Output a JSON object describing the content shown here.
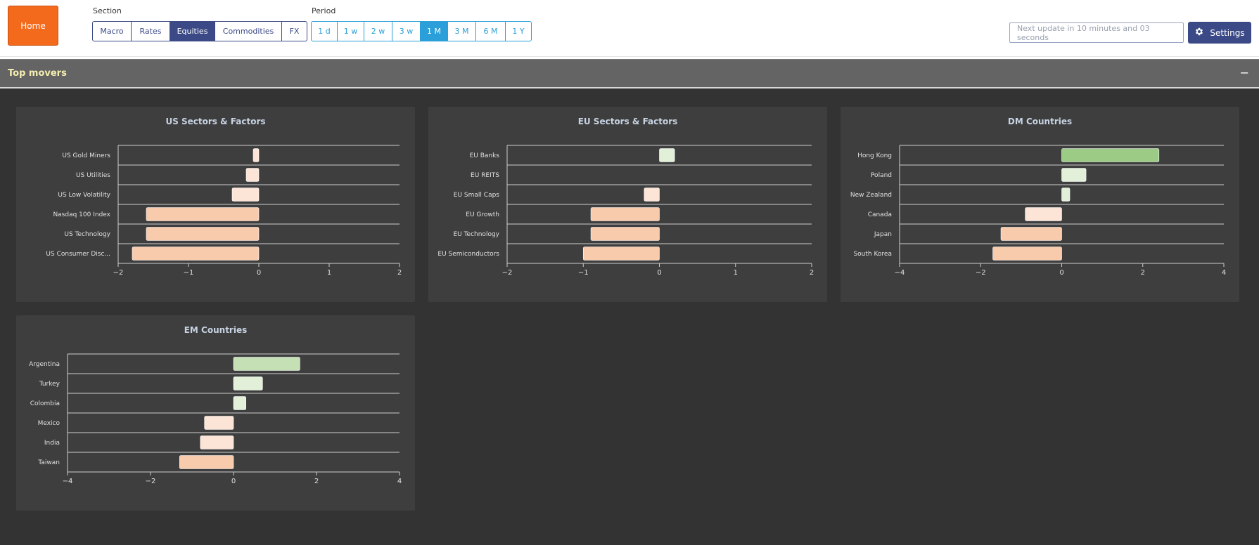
{
  "toolbar": {
    "home_label": "Home",
    "section_label": "Section",
    "sections": [
      {
        "label": "Macro",
        "active": false
      },
      {
        "label": "Rates",
        "active": false
      },
      {
        "label": "Equities",
        "active": true
      },
      {
        "label": "Commodities",
        "active": false
      },
      {
        "label": "FX",
        "active": false
      }
    ],
    "period_label": "Period",
    "periods": [
      {
        "label": "1 d",
        "active": false
      },
      {
        "label": "1 w",
        "active": false
      },
      {
        "label": "2 w",
        "active": false
      },
      {
        "label": "3 w",
        "active": false
      },
      {
        "label": "1 M",
        "active": true
      },
      {
        "label": "3 M",
        "active": false
      },
      {
        "label": "6 M",
        "active": false
      },
      {
        "label": "1 Y",
        "active": false
      }
    ],
    "update_placeholder": "Next update in 10 minutes and 03 seconds",
    "settings_label": "Settings",
    "settings_icon": "gear-icon"
  },
  "movers": {
    "title": "Top movers",
    "collapse_glyph": "−"
  },
  "colors": {
    "accent_section": "#3b4a86",
    "accent_period": "#2b9fd9",
    "home": "#f46a1c",
    "positive_strong": "#9ccb86",
    "positive_mid": "#c5e0b4",
    "positive_light": "#e2f0d9",
    "negative_light": "#fce4d6",
    "negative_mid": "#f8cbad"
  },
  "chart_data": [
    {
      "type": "bar",
      "orientation": "horizontal",
      "title": "US Sectors & Factors",
      "categories": [
        "US Gold Miners",
        "US Utilities",
        "US Low Volatility",
        "Nasdaq 100 Index",
        "US Technology",
        "US Consumer Disc..."
      ],
      "values": [
        -0.08,
        -0.18,
        -0.38,
        -1.6,
        -1.6,
        -1.8
      ],
      "xlim": [
        -2,
        2
      ],
      "xticks": [
        -2,
        -1,
        0,
        1,
        2
      ],
      "grid": true
    },
    {
      "type": "bar",
      "orientation": "horizontal",
      "title": "EU Sectors & Factors",
      "categories": [
        "EU Banks",
        "EU REITS",
        "EU Small Caps",
        "EU Growth",
        "EU Technology",
        "EU Semiconductors"
      ],
      "values": [
        0.2,
        0,
        -0.2,
        -0.9,
        -0.9,
        -1.0
      ],
      "xlim": [
        -2,
        2
      ],
      "xticks": [
        -2,
        -1,
        0,
        1,
        2
      ],
      "grid": true
    },
    {
      "type": "bar",
      "orientation": "horizontal",
      "title": "DM Countries",
      "categories": [
        "Hong Kong",
        "Poland",
        "New Zealand",
        "Canada",
        "Japan",
        "South Korea"
      ],
      "values": [
        2.4,
        0.6,
        0.2,
        -0.9,
        -1.5,
        -1.7
      ],
      "xlim": [
        -4,
        4
      ],
      "xticks": [
        -4,
        -2,
        0,
        2,
        4
      ],
      "grid": true
    },
    {
      "type": "bar",
      "orientation": "horizontal",
      "title": "EM Countries",
      "categories": [
        "Argentina",
        "Turkey",
        "Colombia",
        "Mexico",
        "India",
        "Taiwan"
      ],
      "values": [
        1.6,
        0.7,
        0.3,
        -0.7,
        -0.8,
        -1.3
      ],
      "xlim": [
        -4,
        4
      ],
      "xticks": [
        -4,
        -2,
        0,
        2,
        4
      ],
      "grid": true
    }
  ]
}
